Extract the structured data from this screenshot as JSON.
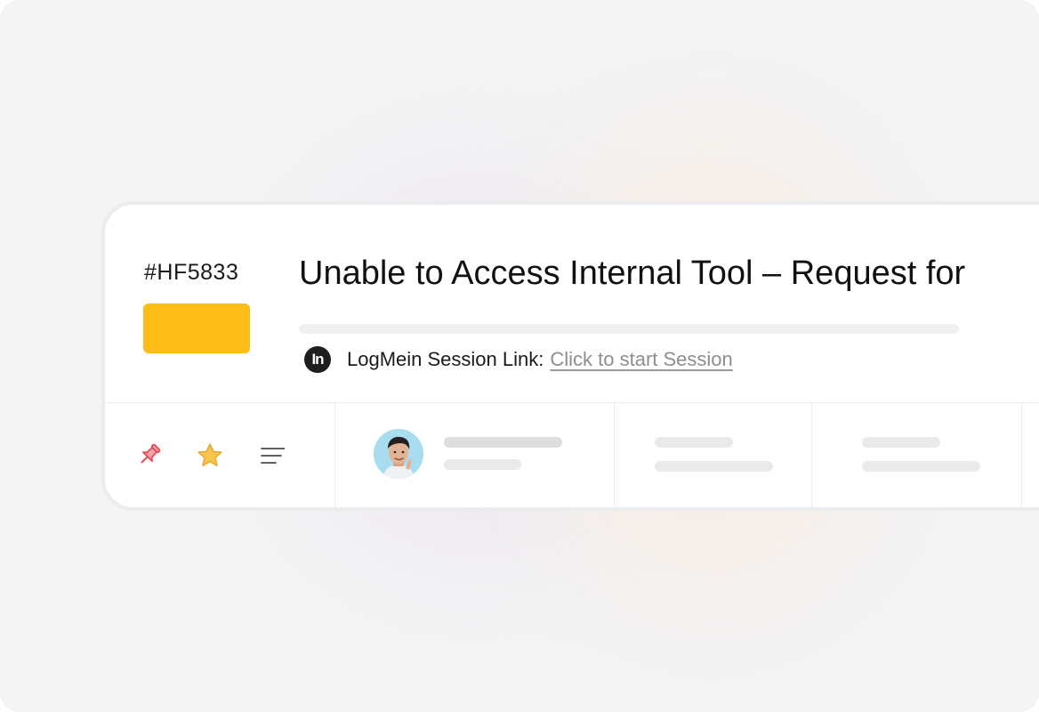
{
  "ticket": {
    "id": "#HF5833",
    "status_color": "#FDBD16",
    "title": "Unable to Access Internal Tool – Request for",
    "session_icon_text": "In",
    "session_label": "LogMein Session Link:",
    "session_link_text": "Click to start Session"
  },
  "actions": {
    "pin_icon": "pushpin-icon",
    "star_icon": "star-icon",
    "menu_icon": "sort-lines-icon",
    "pin_color": "#F0525A",
    "star_color": "#F7C245"
  },
  "assignee": {
    "avatar_icon": "person-avatar"
  }
}
